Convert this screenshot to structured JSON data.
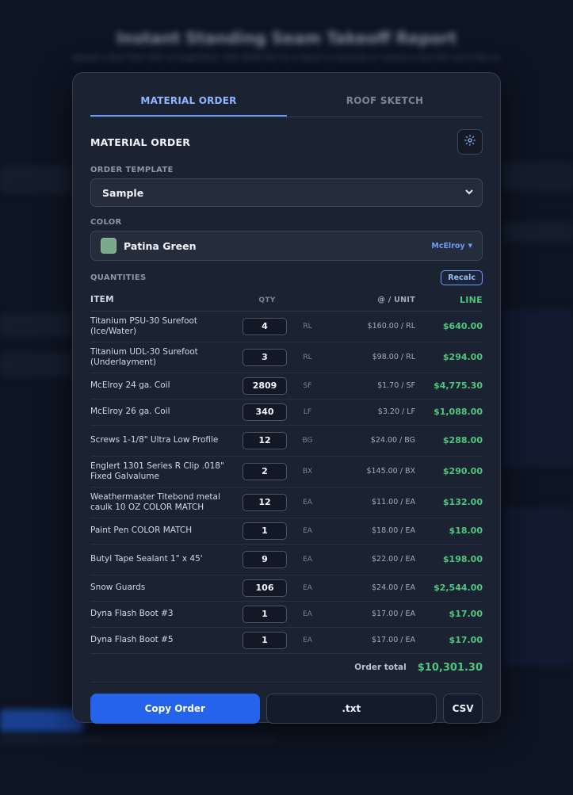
{
  "background": {
    "title": "Instant Standing Seam Takeoff Report",
    "subtitle": "Upload a Roof Plan PDF or EagleView, with NVIR file for a report in seconds or submit a text file you'd like to."
  },
  "tabs": [
    {
      "label": "MATERIAL ORDER",
      "active": true
    },
    {
      "label": "ROOF SKETCH",
      "active": false
    }
  ],
  "section": {
    "title": "MATERIAL ORDER",
    "settings_icon": "gear-icon"
  },
  "template": {
    "label": "ORDER TEMPLATE",
    "value": "Sample"
  },
  "color": {
    "label": "COLOR",
    "name": "Patina Green",
    "swatch": "#7aa88a",
    "brand": "McElroy"
  },
  "quantities": {
    "label": "QUANTITIES",
    "recalc_label": "Recalc",
    "columns": {
      "item": "ITEM",
      "qty": "QTY",
      "unit": "@ / UNIT",
      "line": "LINE"
    },
    "rows": [
      {
        "item": "Titanium PSU-30 Surefoot (Ice/Water)",
        "qty": "4",
        "uom": "RL",
        "unit": "$160.00 / RL",
        "line": "$640.00"
      },
      {
        "item": "Titanium UDL-30 Surefoot (Underlayment)",
        "qty": "3",
        "uom": "RL",
        "unit": "$98.00 / RL",
        "line": "$294.00"
      },
      {
        "item": "McElroy 24 ga. Coil",
        "qty": "2809",
        "uom": "SF",
        "unit": "$1.70 / SF",
        "line": "$4,775.30"
      },
      {
        "item": "McElroy 26 ga. Coil",
        "qty": "340",
        "uom": "LF",
        "unit": "$3.20 / LF",
        "line": "$1,088.00"
      },
      {
        "item": "Screws 1-1/8\" Ultra Low Profile",
        "qty": "12",
        "uom": "BG",
        "unit": "$24.00 / BG",
        "line": "$288.00"
      },
      {
        "item": "Englert 1301 Series R Clip .018\" Fixed Galvalume",
        "qty": "2",
        "uom": "BX",
        "unit": "$145.00 / BX",
        "line": "$290.00"
      },
      {
        "item": "Weathermaster Titebond metal caulk 10 OZ COLOR MATCH",
        "qty": "12",
        "uom": "EA",
        "unit": "$11.00 / EA",
        "line": "$132.00"
      },
      {
        "item": "Paint Pen COLOR MATCH",
        "qty": "1",
        "uom": "EA",
        "unit": "$18.00 / EA",
        "line": "$18.00"
      },
      {
        "item": "Butyl Tape Sealant 1\" x 45'",
        "qty": "9",
        "uom": "EA",
        "unit": "$22.00 / EA",
        "line": "$198.00"
      },
      {
        "item": "Snow Guards",
        "qty": "106",
        "uom": "EA",
        "unit": "$24.00 / EA",
        "line": "$2,544.00"
      },
      {
        "item": "Dyna Flash Boot #3",
        "qty": "1",
        "uom": "EA",
        "unit": "$17.00 / EA",
        "line": "$17.00"
      },
      {
        "item": "Dyna Flash Boot #5",
        "qty": "1",
        "uom": "EA",
        "unit": "$17.00 / EA",
        "line": "$17.00"
      }
    ]
  },
  "total": {
    "label": "Order total",
    "value": "$10,301.30"
  },
  "actions": {
    "copy": "Copy Order",
    "txt": ".txt",
    "csv": "CSV"
  },
  "colors": {
    "accent": "#2563eb",
    "positive": "#4ec77e",
    "tab_active": "#8fb6ff"
  }
}
